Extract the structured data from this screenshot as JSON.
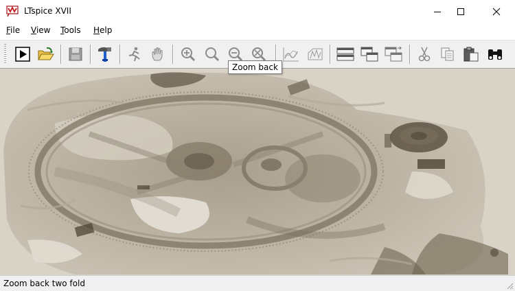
{
  "window": {
    "title": "LTspice XVII"
  },
  "menu": [
    "File",
    "View",
    "Tools",
    "Help"
  ],
  "toolbar_icons": [
    "run-icon",
    "open-folder-icon",
    "save-icon",
    "control-panel-hammer-icon",
    "halt-runner-icon",
    "pan-hand-icon",
    "zoom-in-icon",
    "zoom-area-icon",
    "zoom-back-icon",
    "zoom-fit-icon",
    "autorange-waveform-icon",
    "fft-icon",
    "tile-horizontal-icon",
    "cascade-windows-icon",
    "close-windows-icon",
    "cut-icon",
    "copy-icon",
    "paste-icon",
    "find-binoculars-icon"
  ],
  "tooltip": "Zoom back",
  "status": {
    "text": "Zoom back two fold"
  },
  "colors": {
    "canvas_bg": "#d9d3c7",
    "sepia_dark": "#5e5444",
    "sepia_mid": "#8b8170",
    "sepia_light": "#b2a998"
  }
}
